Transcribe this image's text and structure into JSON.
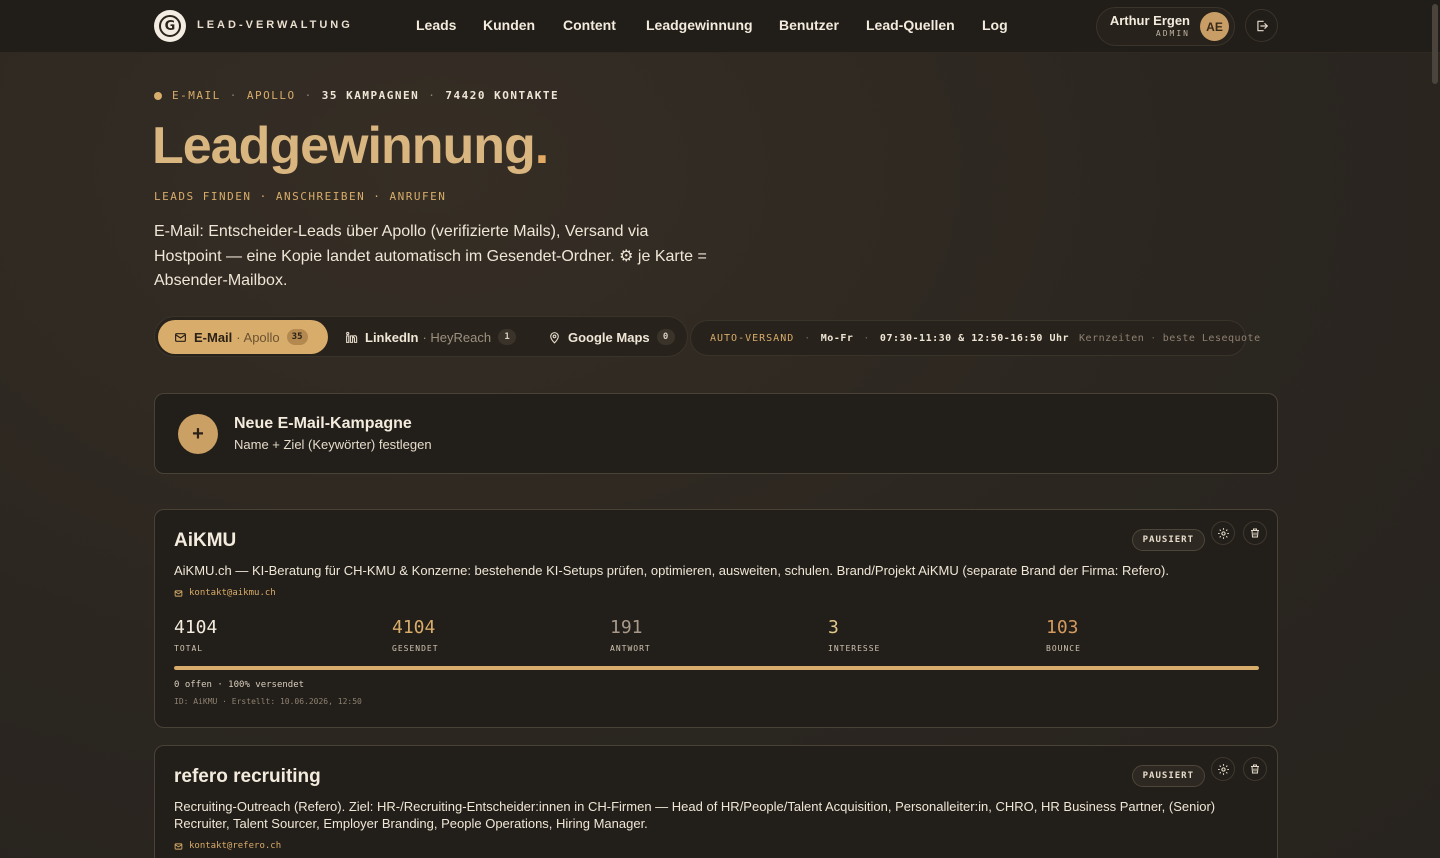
{
  "app": {
    "brand": "LEAD-VERWALTUNG",
    "logo_letter": "G"
  },
  "nav": [
    {
      "label": "Leads"
    },
    {
      "label": "Kunden"
    },
    {
      "label": "Content"
    },
    {
      "label": "Leadgewinnung"
    },
    {
      "label": "Benutzer"
    },
    {
      "label": "Lead-Quellen"
    },
    {
      "label": "Log"
    }
  ],
  "user": {
    "name": "Arthur Ergen",
    "role": "ADMIN",
    "initials": "AE"
  },
  "header": {
    "meta": {
      "channel": "E-MAIL",
      "source": "APOLLO",
      "campaigns": "35 KAMPAGNEN",
      "contacts": "74420 KONTAKTE",
      "sep": "·"
    },
    "title": "Leadgewinnung",
    "title_period": ".",
    "subtitle": "LEADS FINDEN · ANSCHREIBEN · ANRUFEN",
    "description": "E-Mail: Entscheider-Leads über Apollo (verifizierte Mails), Versand via Hostpoint — eine Kopie landet automatisch im Gesendet-Ordner. ⚙ je Karte = Absender-Mailbox."
  },
  "channels": [
    {
      "label": "E-Mail",
      "sub": "· Apollo",
      "count": "35",
      "icon": "mail-icon",
      "active": true
    },
    {
      "label": "LinkedIn",
      "sub": "· HeyReach",
      "count": "1",
      "icon": "linkedin-icon",
      "active": false
    },
    {
      "label": "Google Maps",
      "sub": "",
      "count": "0",
      "icon": "map-pin-icon",
      "active": false
    }
  ],
  "auto_send": {
    "label": "AUTO-VERSAND",
    "days": "Mo-Fr",
    "times": "07:30-11:30 & 12:50-16:50 Uhr",
    "note1": "Kernzeiten",
    "note2": "beste Lesequote",
    "sep": "·"
  },
  "new_campaign": {
    "title": "Neue E-Mail-Kampagne",
    "subtitle": "Name + Ziel (Keywörter) festlegen",
    "icon": "+"
  },
  "campaigns": [
    {
      "name": "AiKMU",
      "status": "PAUSIERT",
      "description": "AiKMU.ch — KI-Beratung für CH-KMU & Konzerne: bestehende KI-Setups prüfen, optimieren, ausweiten, schulen. Brand/Projekt AiKMU (separate Brand der Firma: Refero).",
      "email": "kontakt@aikmu.ch",
      "stats": [
        {
          "value": "4104",
          "label": "TOTAL",
          "color": "#f3ebdd"
        },
        {
          "value": "4104",
          "label": "GESENDET",
          "color": "#d8ac6a"
        },
        {
          "value": "191",
          "label": "ANTWORT",
          "color": "#a8998a"
        },
        {
          "value": "3",
          "label": "INTERESSE",
          "color": "#e0c98a"
        },
        {
          "value": "103",
          "label": "BOUNCE",
          "color": "#d39a5e"
        }
      ],
      "progress_pct": 100,
      "footer": "0 offen · 100% versendet",
      "meta": "ID: AiKMU · Erstellt: 10.06.2026, 12:50"
    },
    {
      "name": "refero recruiting",
      "status": "PAUSIERT",
      "description": "Recruiting-Outreach (Refero). Ziel: HR-/Recruiting-Entscheider:innen in CH-Firmen — Head of HR/People/Talent Acquisition, Personalleiter:in, CHRO, HR Business Partner, (Senior) Recruiter, Talent Sourcer, Employer Branding, People Operations, Hiring Manager.",
      "email": "kontakt@refero.ch"
    }
  ],
  "colors": {
    "accent": "#d8ac6a",
    "background": "#2b2620",
    "card": "#221e19"
  }
}
